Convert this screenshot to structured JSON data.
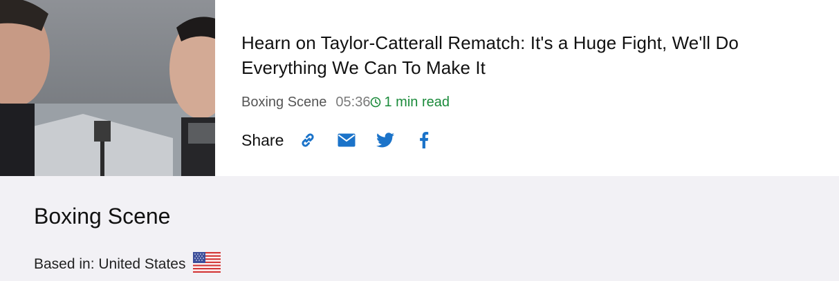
{
  "article": {
    "image_alt": "Two men facing each other outdoors",
    "headline": "Hearn on Taylor-Catterall Rematch: It's a Huge Fight, We'll Do Everything We Can To Make It",
    "source": "Boxing Scene",
    "time": "05:36",
    "read_time": "1 min read",
    "share_label": "Share"
  },
  "share_icons": [
    "link-icon",
    "email-icon",
    "twitter-icon",
    "facebook-icon"
  ],
  "source_box": {
    "name": "Boxing Scene",
    "based_in": "Based in: United States",
    "flag": "us-flag-icon"
  },
  "colors": {
    "accent_blue": "#1b73c9",
    "read_green": "#1a8a3a",
    "panel_bg": "#f2f1f5"
  }
}
